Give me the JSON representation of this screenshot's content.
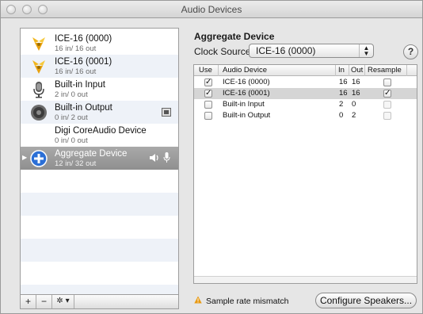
{
  "window": {
    "title": "Audio Devices"
  },
  "devices": [
    {
      "name": "ICE-16 (0000)",
      "io": "16 in/ 16 out",
      "icon": "device-chip-icon"
    },
    {
      "name": "ICE-16 (0001)",
      "io": "16 in/ 16 out",
      "icon": "device-chip-icon"
    },
    {
      "name": "Built-in Input",
      "io": "2 in/ 0 out",
      "icon": "microphone-icon"
    },
    {
      "name": "Built-in Output",
      "io": "0 in/ 2 out",
      "icon": "speaker-icon"
    },
    {
      "name": "Digi CoreAudio Device",
      "io": "0 in/ 0 out",
      "icon": "none"
    },
    {
      "name": "Aggregate Device",
      "io": "12 in/ 32 out",
      "icon": "aggregate-plus-icon"
    }
  ],
  "list_footer": {
    "add": "+",
    "remove": "−",
    "action": "✲ ▾"
  },
  "panel": {
    "title": "Aggregate Device",
    "clock_label": "Clock Source:",
    "clock_value": "ICE-16 (0000)",
    "help": "?"
  },
  "table": {
    "headers": [
      "Use",
      "Audio Device",
      "In",
      "Out",
      "Resample"
    ],
    "rows": [
      {
        "use": true,
        "device": "ICE-16 (0000)",
        "in": "16",
        "out": "16",
        "resample": false,
        "resample_enabled": true
      },
      {
        "use": true,
        "device": "ICE-16 (0001)",
        "in": "16",
        "out": "16",
        "resample": true,
        "resample_enabled": true
      },
      {
        "use": false,
        "device": "Built-in Input",
        "in": "2",
        "out": "0",
        "resample": false,
        "resample_enabled": false
      },
      {
        "use": false,
        "device": "Built-in Output",
        "in": "0",
        "out": "2",
        "resample": false,
        "resample_enabled": false
      }
    ]
  },
  "status": {
    "warning": "Sample rate mismatch"
  },
  "buttons": {
    "configure": "Configure Speakers..."
  },
  "colors": {
    "selection": "#9e9e9e",
    "alt_row": "#eef2f8",
    "accent_blue": "#2b6fd6",
    "warning": "#e89a12"
  }
}
